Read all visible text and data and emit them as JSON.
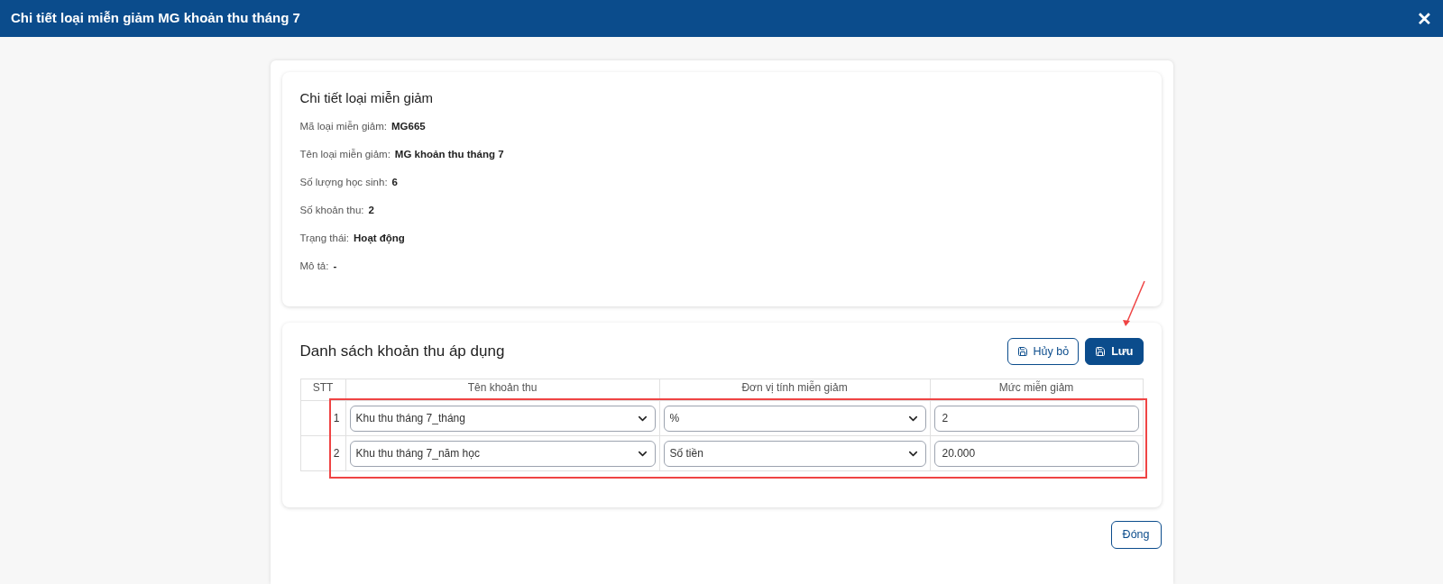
{
  "window": {
    "title": "Chi tiết loại miễn giảm MG khoản thu tháng 7",
    "close": "✕"
  },
  "details": {
    "title": "Chi tiết loại miễn giảm",
    "fields": [
      {
        "label": "Mã loại miễn giảm:",
        "value": "MG665"
      },
      {
        "label": "Tên loại miễn giảm:",
        "value": "MG khoản thu tháng 7"
      },
      {
        "label": "Số lượng học sinh:",
        "value": "6"
      },
      {
        "label": "Số khoản thu:",
        "value": "2"
      },
      {
        "label": "Trạng thái:",
        "value": "Hoạt động"
      },
      {
        "label": "Mô tả:",
        "value": "-"
      }
    ]
  },
  "fees": {
    "title": "Danh sách khoản thu áp dụng",
    "buttons": [
      {
        "label": "Hủy bỏ",
        "kind": "outline"
      },
      {
        "label": "Lưu",
        "kind": "primary"
      }
    ],
    "table": {
      "columns": [
        "STT",
        "Tên khoản thu",
        "Đơn vị tính miễn giảm",
        "Mức miễn giảm"
      ],
      "rows": [
        {
          "index": "1",
          "fee": "Khu thu tháng 7_tháng",
          "unit": "%",
          "amount": "2"
        },
        {
          "index": "2",
          "fee": "Khu thu tháng 7_năm học",
          "unit": "Số tiền",
          "amount": "20.000"
        }
      ]
    }
  },
  "footer": {
    "close_button": "Đóng"
  }
}
